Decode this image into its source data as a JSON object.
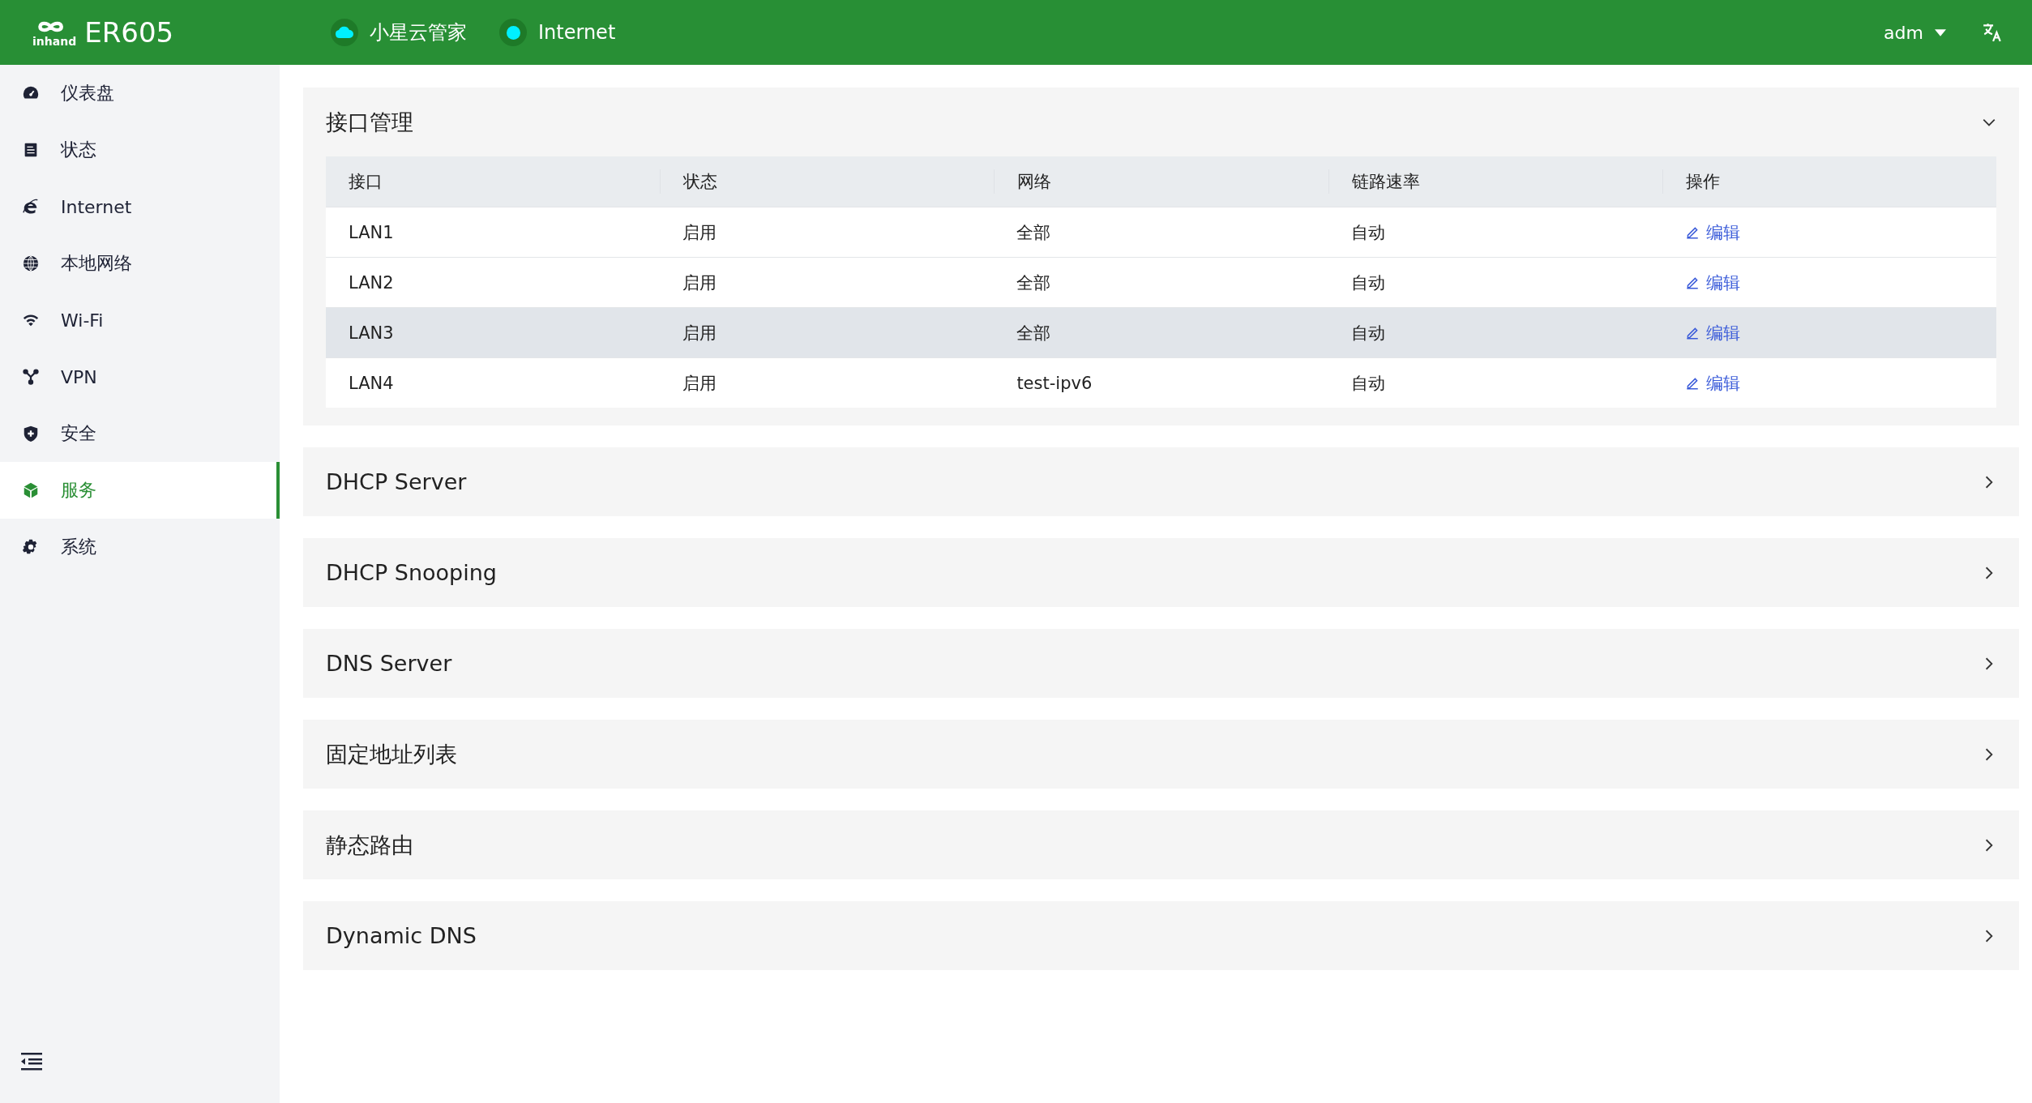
{
  "header": {
    "logo_text": "inhand",
    "model": "ER605",
    "status": [
      {
        "kind": "cloud",
        "label": "小星云管家",
        "connected": true
      },
      {
        "kind": "dot",
        "label": "Internet",
        "connected": true
      }
    ],
    "user": "adm"
  },
  "sidebar": {
    "items": [
      {
        "label": "仪表盘",
        "selected": false
      },
      {
        "label": "状态",
        "selected": false
      },
      {
        "label": "Internet",
        "selected": false
      },
      {
        "label": "本地网络",
        "selected": false
      },
      {
        "label": "Wi-Fi",
        "selected": false
      },
      {
        "label": "VPN",
        "selected": false
      },
      {
        "label": "安全",
        "selected": false
      },
      {
        "label": "服务",
        "selected": true
      },
      {
        "label": "系统",
        "selected": false
      }
    ]
  },
  "sections": [
    {
      "title": "接口管理",
      "expanded": true,
      "table": {
        "columns": [
          "接口",
          "状态",
          "网络",
          "链路速率",
          "操作"
        ],
        "rows": [
          {
            "cells": [
              "LAN1",
              "启用",
              "全部",
              "自动"
            ],
            "action": "编辑",
            "highlighted": false
          },
          {
            "cells": [
              "LAN2",
              "启用",
              "全部",
              "自动"
            ],
            "action": "编辑",
            "highlighted": false
          },
          {
            "cells": [
              "LAN3",
              "启用",
              "全部",
              "自动"
            ],
            "action": "编辑",
            "highlighted": true
          },
          {
            "cells": [
              "LAN4",
              "启用",
              "test-ipv6",
              "自动"
            ],
            "action": "编辑",
            "highlighted": false
          }
        ]
      }
    },
    {
      "title": "DHCP Server",
      "expanded": false
    },
    {
      "title": "DHCP Snooping",
      "expanded": false
    },
    {
      "title": "DNS Server",
      "expanded": false
    },
    {
      "title": "固定地址列表",
      "expanded": false
    },
    {
      "title": "静态路由",
      "expanded": false
    },
    {
      "title": "Dynamic DNS",
      "expanded": false
    }
  ]
}
